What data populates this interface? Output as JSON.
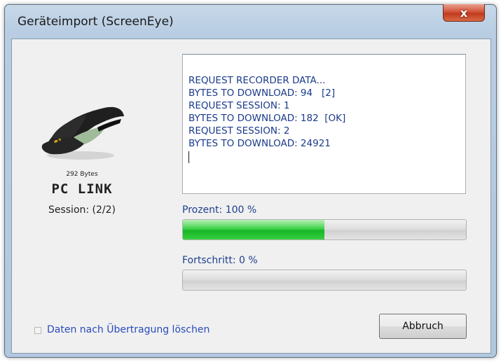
{
  "window": {
    "title": "Geräteimport (ScreenEye)",
    "close_glyph": "x"
  },
  "device": {
    "bytes": "292 Bytes",
    "name": "PC  LINK",
    "session": "Session: (2/2)",
    "image_icon": "visor-cap-icon"
  },
  "log": {
    "lines": [
      "REQUEST RECORDER DATA...",
      "BYTES TO DOWNLOAD: 94   [2]",
      "REQUEST SESSION: 1",
      "BYTES TO DOWNLOAD: 182  [OK]",
      "REQUEST SESSION: 2",
      "BYTES TO DOWNLOAD: 24921"
    ]
  },
  "progress": {
    "percent_label": "Prozent: 100 %",
    "percent_fill": 0.5,
    "step_label": "Fortschritt: 0 %",
    "step_fill": 0
  },
  "options": {
    "delete_after_transfer": "Daten nach Übertragung löschen",
    "checked": false
  },
  "buttons": {
    "cancel": "Abbruch"
  },
  "colors": {
    "accent_text": "#1e3f8c",
    "progress_green": "#17b524",
    "close_red": "#c23a1f"
  }
}
